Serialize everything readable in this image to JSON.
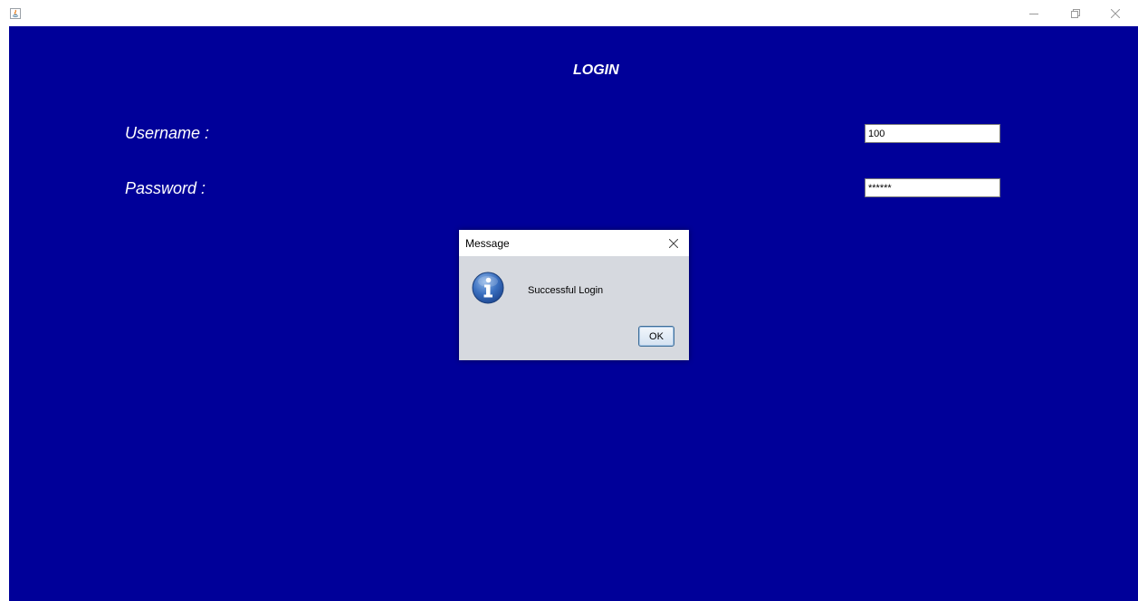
{
  "window": {
    "app_icon": "java-icon",
    "controls": [
      "minimize-icon",
      "maximize-icon",
      "close-icon"
    ]
  },
  "form": {
    "title": "LOGIN",
    "username_label": "Username :",
    "username_value": "100",
    "password_label": "Password :",
    "password_value": "******"
  },
  "dialog": {
    "title": "Message",
    "icon": "info-icon",
    "message": "Successful Login",
    "ok_label": "OK"
  },
  "colors": {
    "background": "#000099",
    "dialog_body": "#d6d9df",
    "text": "#ffffff"
  }
}
